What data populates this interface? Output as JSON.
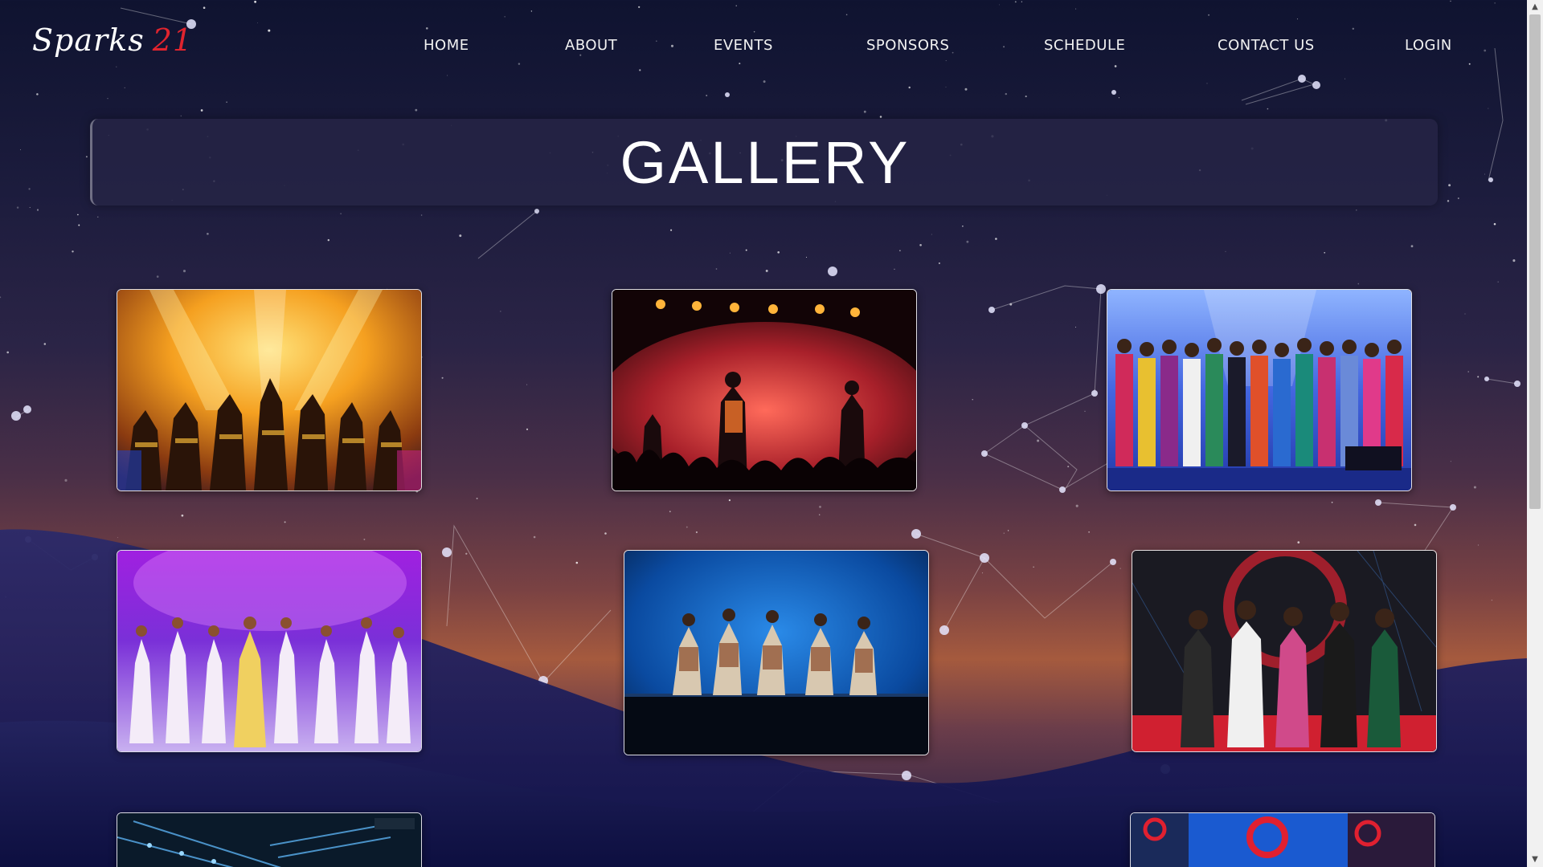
{
  "brand": {
    "name": "Sparks",
    "year": "21",
    "accent_color": "#e0242e"
  },
  "nav": {
    "items": [
      {
        "label": "HOME"
      },
      {
        "label": "ABOUT"
      },
      {
        "label": "EVENTS"
      },
      {
        "label": "SPONSORS"
      },
      {
        "label": "SCHEDULE"
      },
      {
        "label": "CONTACT US"
      },
      {
        "label": "LOGIN"
      }
    ]
  },
  "gallery": {
    "title": "GALLERY",
    "photos": [
      {
        "subject": "dance troupe under yellow and orange stage lights"
      },
      {
        "subject": "band performing on stage with red smoke"
      },
      {
        "subject": "fashion show models on blue lit stage"
      },
      {
        "subject": "dancers in white costumes under purple light"
      },
      {
        "subject": "group dance on blue lit stage"
      },
      {
        "subject": "group photo at event backdrop"
      },
      {
        "subject": "stage lighting rig"
      },
      {
        "subject": "event stage with sponsor banners"
      }
    ]
  },
  "scrollbar": {
    "up_glyph": "▲",
    "down_glyph": "▼"
  }
}
